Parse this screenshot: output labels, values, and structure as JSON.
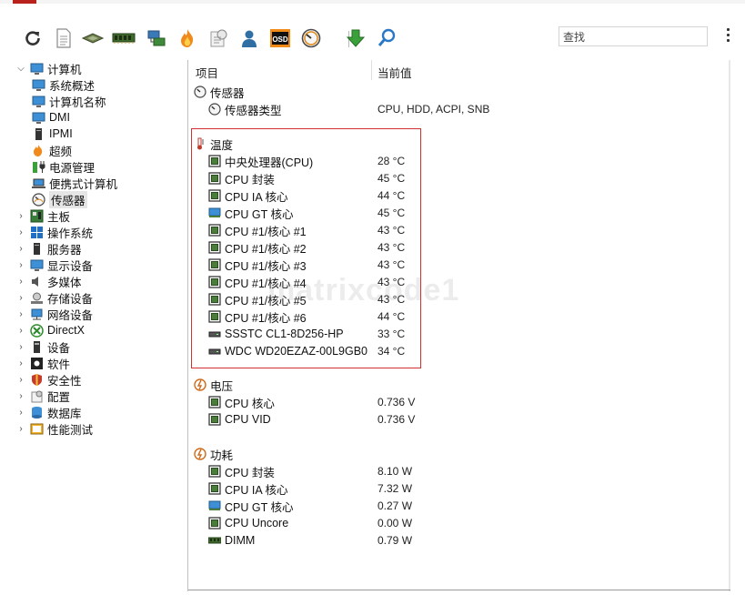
{
  "toolbar": {
    "search_value": "查找",
    "icons": [
      "refresh-icon",
      "report-icon",
      "memory-icon",
      "ram-icon",
      "network-icon",
      "burn-icon",
      "benchmark-icon",
      "user-icon",
      "osd-icon",
      "sensor-icon",
      "update-icon",
      "search-icon"
    ]
  },
  "tree": {
    "items": [
      {
        "label": "计算机",
        "expanded": true
      },
      {
        "label": "系统概述"
      },
      {
        "label": "计算机名称"
      },
      {
        "label": "DMI"
      },
      {
        "label": "IPMI"
      },
      {
        "label": "超频"
      },
      {
        "label": "电源管理"
      },
      {
        "label": "便携式计算机"
      },
      {
        "label": "传感器",
        "selected": true
      },
      {
        "label": "主板"
      },
      {
        "label": "操作系统"
      },
      {
        "label": "服务器"
      },
      {
        "label": "显示设备"
      },
      {
        "label": "多媒体"
      },
      {
        "label": "存储设备"
      },
      {
        "label": "网络设备"
      },
      {
        "label": "DirectX"
      },
      {
        "label": "设备"
      },
      {
        "label": "软件"
      },
      {
        "label": "安全性"
      },
      {
        "label": "配置"
      },
      {
        "label": "数据库"
      },
      {
        "label": "性能测试"
      }
    ]
  },
  "columns": {
    "item": "项目",
    "value": "当前值"
  },
  "sections": {
    "sensor": {
      "title": "传感器",
      "rows": [
        {
          "label": "传感器类型",
          "value": "CPU, HDD, ACPI, SNB"
        }
      ]
    },
    "temperature": {
      "title": "温度",
      "rows": [
        {
          "label": "中央处理器(CPU)",
          "value": "28 °C"
        },
        {
          "label": "CPU 封装",
          "value": "45 °C"
        },
        {
          "label": "CPU IA 核心",
          "value": "44 °C"
        },
        {
          "label": "CPU GT 核心",
          "value": "45 °C"
        },
        {
          "label": "CPU #1/核心 #1",
          "value": "43 °C"
        },
        {
          "label": "CPU #1/核心 #2",
          "value": "43 °C"
        },
        {
          "label": "CPU #1/核心 #3",
          "value": "43 °C"
        },
        {
          "label": "CPU #1/核心 #4",
          "value": "43 °C"
        },
        {
          "label": "CPU #1/核心 #5",
          "value": "43 °C"
        },
        {
          "label": "CPU #1/核心 #6",
          "value": "44 °C"
        },
        {
          "label": "SSSTC CL1-8D256-HP",
          "value": "33 °C"
        },
        {
          "label": "WDC WD20EZAZ-00L9GB0",
          "value": "34 °C"
        }
      ]
    },
    "voltage": {
      "title": "电压",
      "rows": [
        {
          "label": "CPU 核心",
          "value": "0.736 V"
        },
        {
          "label": "CPU VID",
          "value": "0.736 V"
        }
      ]
    },
    "power": {
      "title": "功耗",
      "rows": [
        {
          "label": "CPU 封装",
          "value": "8.10 W"
        },
        {
          "label": "CPU IA 核心",
          "value": "7.32 W"
        },
        {
          "label": "CPU GT 核心",
          "value": "0.27 W"
        },
        {
          "label": "CPU Uncore",
          "value": "0.00 W"
        },
        {
          "label": "DIMM",
          "value": "0.79 W"
        }
      ]
    }
  },
  "watermark": "matrixcode1",
  "colors": {
    "highlight_box": "#d33030"
  }
}
